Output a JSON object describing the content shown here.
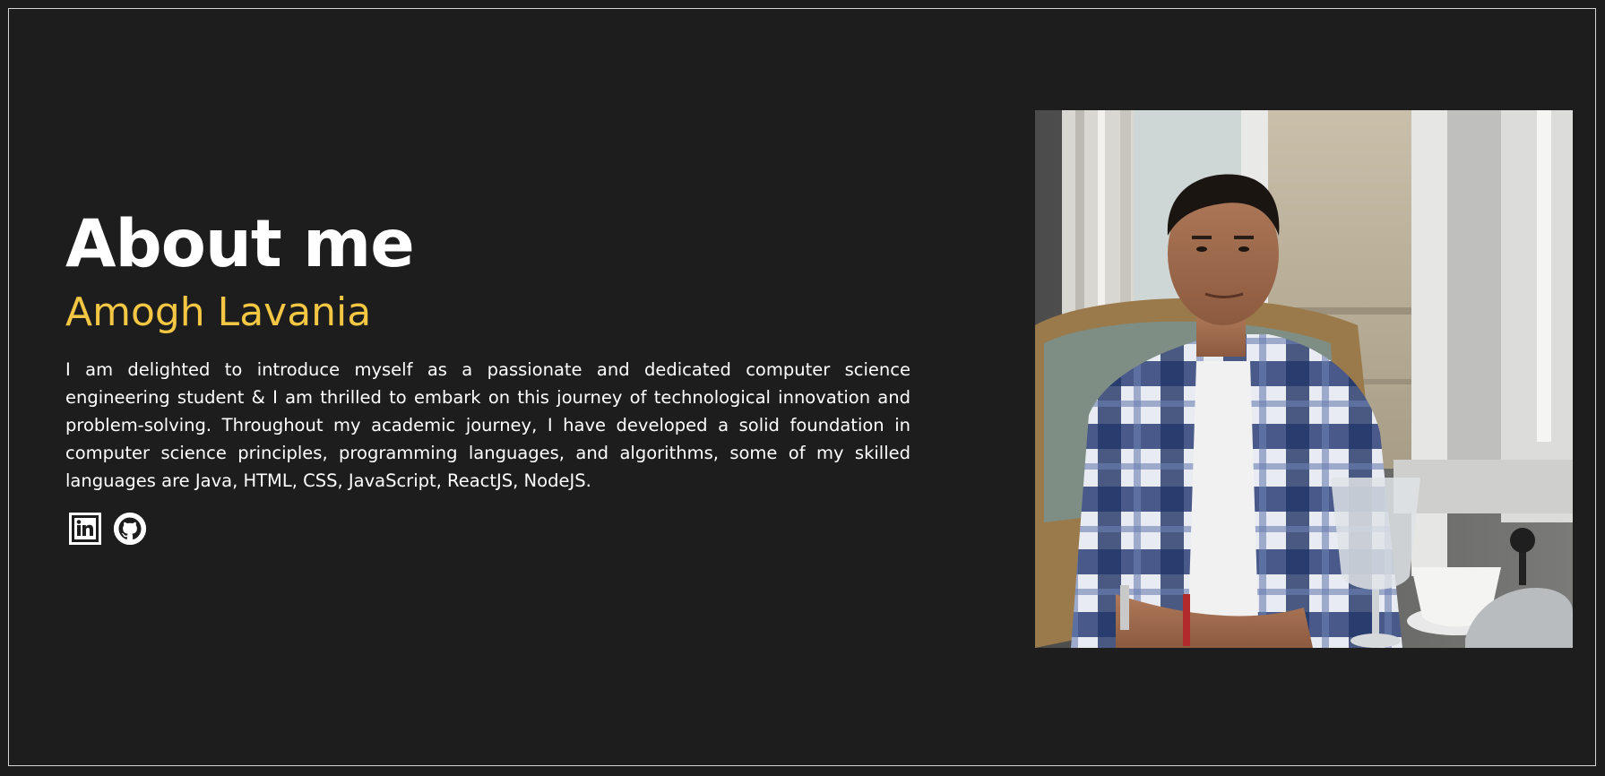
{
  "about": {
    "heading": "About me",
    "name": "Amogh Lavania",
    "bio": "I am delighted to introduce myself as a passionate and dedicated computer science engineering student & I am thrilled to embark on this journey of technological innovation and problem-solving. Throughout my academic journey, I have developed a solid foundation in computer science principles, programming languages, and algorithms, some of my skilled languages are Java, HTML, CSS, JavaScript, ReactJS, NodeJS."
  },
  "socials": [
    {
      "icon": "linkedin-icon"
    },
    {
      "icon": "github-icon"
    }
  ],
  "colors": {
    "background": "#1d1d1d",
    "frame_border": "#d8d8d8",
    "heading": "#ffffff",
    "accent_name": "#f3c744",
    "body_text": "#ffffff"
  }
}
